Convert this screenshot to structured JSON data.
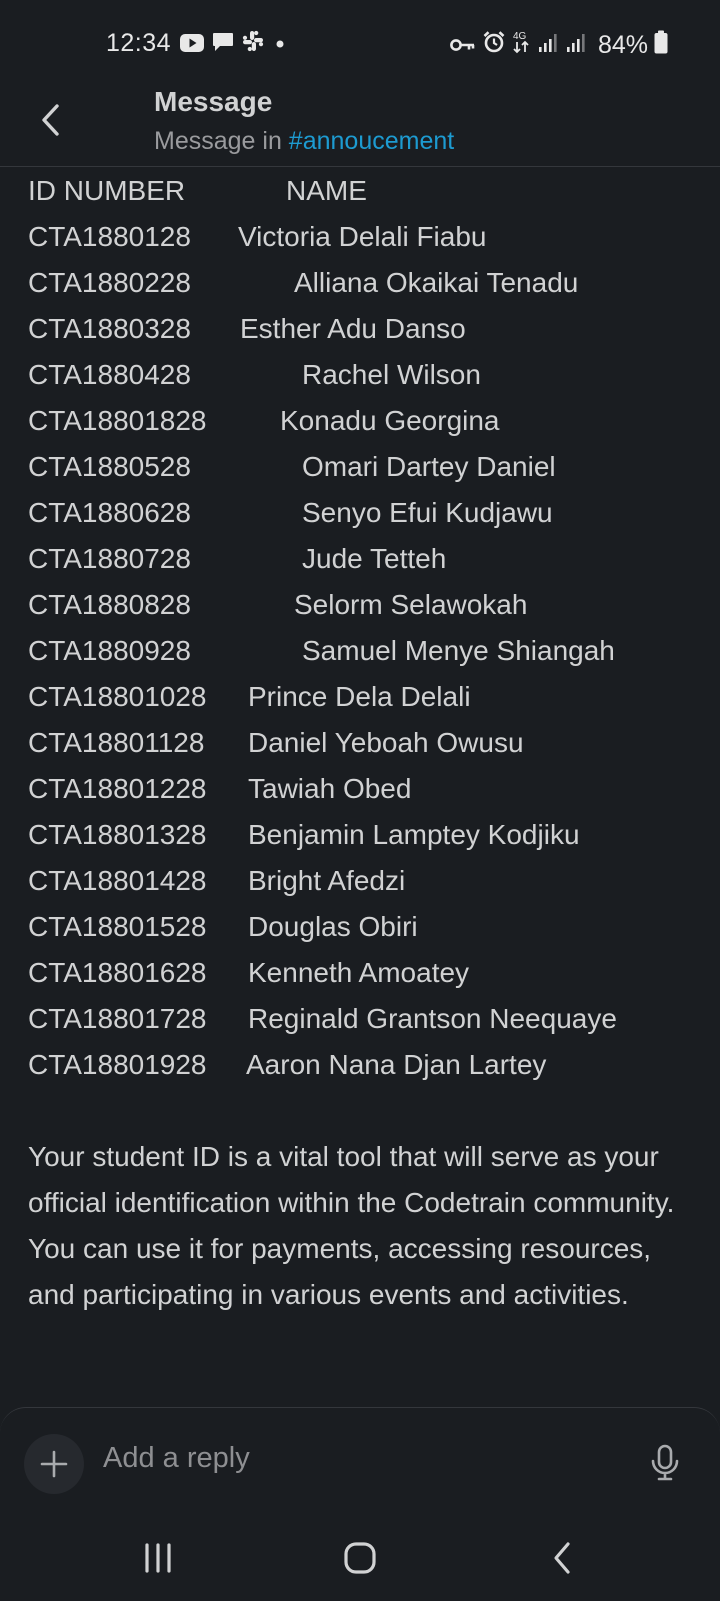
{
  "status_bar": {
    "time": "12:34",
    "battery": "84%",
    "network": "4G",
    "left_icons": [
      "youtube-icon",
      "chat-icon",
      "slack-icon",
      "dot-icon"
    ],
    "right_icons": [
      "key-icon",
      "alarm-icon",
      "data-arrows-icon",
      "signal-icon",
      "signal-icon",
      "battery-icon"
    ]
  },
  "header": {
    "title": "Message",
    "subtitle_prefix": "Message in ",
    "channel": "#annoucement"
  },
  "message": {
    "table_header": {
      "id": "ID NUMBER",
      "name": "NAME"
    },
    "rows": [
      {
        "id": "CTA1880128",
        "name": "Victoria Delali Fiabu"
      },
      {
        "id": "CTA1880228",
        "name": "Alliana Okaikai Tenadu"
      },
      {
        "id": "CTA1880328",
        "name": "Esther Adu Danso"
      },
      {
        "id": "CTA1880428",
        "name": "Rachel Wilson"
      },
      {
        "id": "CTA18801828",
        "name": "Konadu Georgina"
      },
      {
        "id": "CTA1880528",
        "name": "Omari Dartey Daniel"
      },
      {
        "id": "CTA1880628",
        "name": "Senyo Efui Kudjawu"
      },
      {
        "id": "CTA1880728",
        "name": "Jude Tetteh"
      },
      {
        "id": "CTA1880828",
        "name": "Selorm Selawokah"
      },
      {
        "id": "CTA1880928",
        "name": "Samuel Menye Shiangah"
      },
      {
        "id": "CTA18801028",
        "name": "Prince Dela Delali"
      },
      {
        "id": "CTA18801128",
        "name": "Daniel Yeboah Owusu"
      },
      {
        "id": "CTA18801228",
        "name": "Tawiah Obed"
      },
      {
        "id": "CTA18801328",
        "name": "Benjamin Lamptey Kodjiku"
      },
      {
        "id": "CTA18801428",
        "name": "Bright Afedzi"
      },
      {
        "id": "CTA18801528",
        "name": "Douglas Obiri"
      },
      {
        "id": "CTA18801628",
        "name": "Kenneth Amoatey"
      },
      {
        "id": "CTA18801728",
        "name": "Reginald Grantson Neequaye"
      },
      {
        "id": "CTA18801928",
        "name": "Aaron Nana Djan Lartey"
      }
    ],
    "paragraph": "Your student ID is a vital tool that will serve as your official identification within the Codetrain community. You can use it for payments, accessing resources, and participating in various events and activities."
  },
  "composer": {
    "placeholder": "Add a reply",
    "plus_icon": "plus-icon",
    "mic_icon": "microphone-icon"
  },
  "nav_bar": {
    "icons": [
      "recent-apps-icon",
      "home-icon",
      "back-icon"
    ]
  },
  "colors": {
    "background": "#1a1d21",
    "text": "#d1d2d3",
    "muted": "#9a9b9e",
    "link": "#1d9bd1",
    "divider": "#34373c"
  }
}
